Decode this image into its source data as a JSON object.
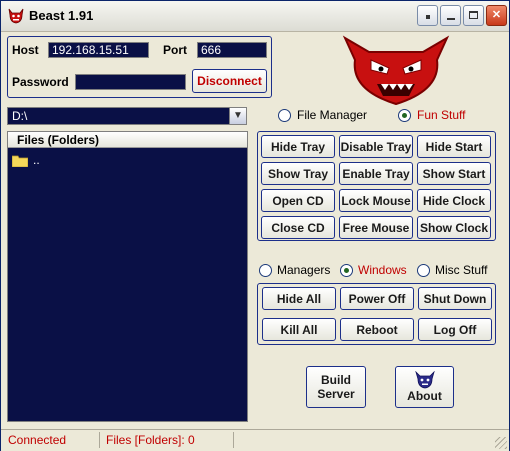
{
  "window": {
    "title": "Beast 1.91"
  },
  "connection": {
    "host_label": "Host",
    "host_value": "192.168.15.51",
    "port_label": "Port",
    "port_value": "666",
    "password_label": "Password",
    "password_value": "",
    "disconnect_label": "Disconnect"
  },
  "drive": {
    "value": "D:\\"
  },
  "files": {
    "header": "Files (Folders)",
    "items": [
      ".."
    ]
  },
  "top_radios": [
    {
      "label": "File Manager",
      "selected": false
    },
    {
      "label": "Fun Stuff",
      "selected": true
    }
  ],
  "fun_buttons": [
    "Hide Tray",
    "Disable Tray",
    "Hide Start",
    "Show Tray",
    "Enable Tray",
    "Show Start",
    "Open CD",
    "Lock Mouse",
    "Hide Clock",
    "Close CD",
    "Free Mouse",
    "Show Clock"
  ],
  "mid_radios": [
    {
      "label": "Managers",
      "selected": false
    },
    {
      "label": "Windows",
      "selected": true
    },
    {
      "label": "Misc Stuff",
      "selected": false
    }
  ],
  "windows_buttons": [
    "Hide All",
    "Power Off",
    "Shut Down",
    "Kill All",
    "Reboot",
    "Log Off"
  ],
  "actions": {
    "build_server": "Build Server",
    "about": "About"
  },
  "status": {
    "connection": "Connected",
    "files": "Files [Folders]: 0"
  },
  "colors": {
    "field_bg": "#0a1046",
    "accent_red": "#c00000",
    "border_blue": "#1c2f8a"
  }
}
